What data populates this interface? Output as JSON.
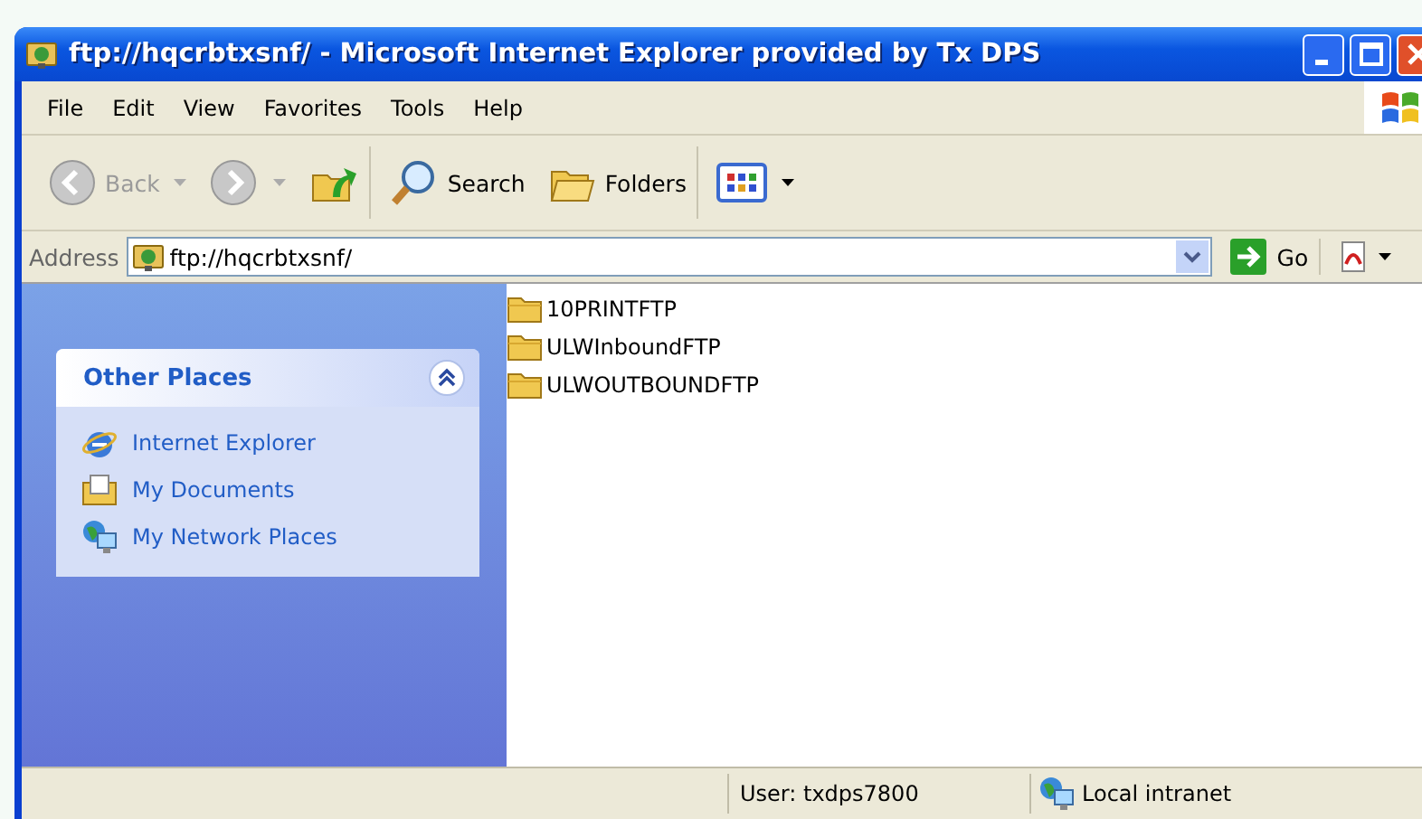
{
  "window": {
    "title": "ftp://hqcrbtxsnf/ - Microsoft Internet Explorer provided by Tx DPS"
  },
  "menu": [
    "File",
    "Edit",
    "View",
    "Favorites",
    "Tools",
    "Help"
  ],
  "toolbar": [
    {
      "kind": "back",
      "label": "Back",
      "disabled": true
    },
    {
      "kind": "forward",
      "disabled": true
    },
    {
      "kind": "up"
    },
    {
      "kind": "search",
      "label": "Search"
    },
    {
      "kind": "folders",
      "label": "Folders"
    },
    {
      "kind": "views"
    }
  ],
  "address": {
    "label": "Address",
    "value": "ftp://hqcrbtxsnf/",
    "go": "Go"
  },
  "sidebar": {
    "panel": {
      "title": "Other Places",
      "expanded": true,
      "items": [
        {
          "kind": "ie",
          "label": "Internet Explorer"
        },
        {
          "kind": "docs",
          "label": "My Documents"
        },
        {
          "kind": "network",
          "label": "My Network Places"
        }
      ]
    }
  },
  "files": [
    {
      "name": "10PRINTFTP"
    },
    {
      "name": "ULWInboundFTP"
    },
    {
      "name": "ULWOUTBOUNDFTP"
    }
  ],
  "status_bar": {
    "user": "User: txdps7800",
    "zone": "Local intranet"
  }
}
